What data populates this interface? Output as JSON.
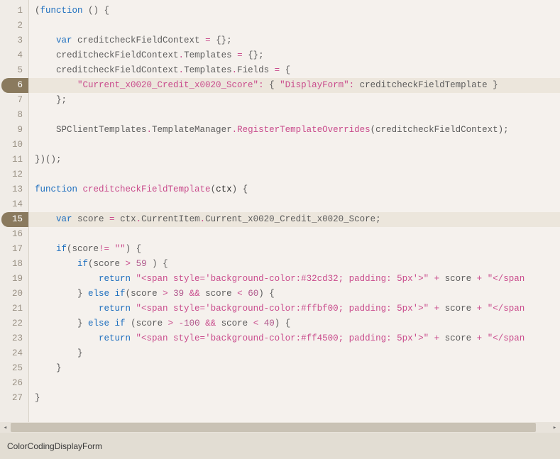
{
  "status_bar": {
    "filename": "ColorCodingDisplayForm"
  },
  "highlighted_lines": [
    6,
    15
  ],
  "code_lines": [
    {
      "n": 1,
      "tokens": [
        [
          "p",
          "("
        ],
        [
          "kw",
          "function"
        ],
        [
          "p",
          " () {"
        ]
      ]
    },
    {
      "n": 2,
      "tokens": []
    },
    {
      "n": 3,
      "tokens": [
        [
          "p",
          "    "
        ],
        [
          "kw",
          "var"
        ],
        [
          "p",
          " creditcheckFieldContext "
        ],
        [
          "op",
          "="
        ],
        [
          "p",
          " {};"
        ]
      ]
    },
    {
      "n": 4,
      "tokens": [
        [
          "p",
          "    creditcheckFieldContext"
        ],
        [
          "op",
          "."
        ],
        [
          "p",
          "Templates "
        ],
        [
          "op",
          "="
        ],
        [
          "p",
          " {};"
        ]
      ]
    },
    {
      "n": 5,
      "tokens": [
        [
          "p",
          "    creditcheckFieldContext"
        ],
        [
          "op",
          "."
        ],
        [
          "p",
          "Templates"
        ],
        [
          "op",
          "."
        ],
        [
          "p",
          "Fields "
        ],
        [
          "op",
          "="
        ],
        [
          "p",
          " {"
        ]
      ]
    },
    {
      "n": 6,
      "tokens": [
        [
          "p",
          "        "
        ],
        [
          "str",
          "\"Current_x0020_Credit_x0020_Score\""
        ],
        [
          "op",
          ":"
        ],
        [
          "p",
          " { "
        ],
        [
          "str",
          "\"DisplayForm\""
        ],
        [
          "op",
          ":"
        ],
        [
          "p",
          " creditcheckFieldTemplate }"
        ]
      ]
    },
    {
      "n": 7,
      "tokens": [
        [
          "p",
          "    };"
        ]
      ]
    },
    {
      "n": 8,
      "tokens": []
    },
    {
      "n": 9,
      "tokens": [
        [
          "p",
          "    SPClientTemplates"
        ],
        [
          "op",
          "."
        ],
        [
          "p",
          "TemplateManager"
        ],
        [
          "op",
          "."
        ],
        [
          "fn",
          "RegisterTemplateOverrides"
        ],
        [
          "p",
          "(creditcheckFieldContext);"
        ]
      ]
    },
    {
      "n": 10,
      "tokens": []
    },
    {
      "n": 11,
      "tokens": [
        [
          "p",
          "})();"
        ]
      ]
    },
    {
      "n": 12,
      "tokens": []
    },
    {
      "n": 13,
      "tokens": [
        [
          "kw",
          "function"
        ],
        [
          "p",
          " "
        ],
        [
          "fn",
          "creditcheckFieldTemplate"
        ],
        [
          "p",
          "("
        ],
        [
          "id",
          "ctx"
        ],
        [
          "p",
          ") {"
        ]
      ]
    },
    {
      "n": 14,
      "tokens": []
    },
    {
      "n": 15,
      "tokens": [
        [
          "p",
          "    "
        ],
        [
          "kw",
          "var"
        ],
        [
          "p",
          " score "
        ],
        [
          "op",
          "="
        ],
        [
          "p",
          " ctx"
        ],
        [
          "op",
          "."
        ],
        [
          "p",
          "CurrentItem"
        ],
        [
          "op",
          "."
        ],
        [
          "p",
          "Current_x0020_Credit_x0020_Score;"
        ]
      ]
    },
    {
      "n": 16,
      "tokens": []
    },
    {
      "n": 17,
      "tokens": [
        [
          "p",
          "    "
        ],
        [
          "kw",
          "if"
        ],
        [
          "p",
          "(score"
        ],
        [
          "op",
          "!="
        ],
        [
          "p",
          " "
        ],
        [
          "str",
          "\"\""
        ],
        [
          "p",
          ") {"
        ]
      ]
    },
    {
      "n": 18,
      "tokens": [
        [
          "p",
          "        "
        ],
        [
          "kw",
          "if"
        ],
        [
          "p",
          "(score "
        ],
        [
          "op",
          ">"
        ],
        [
          "p",
          " "
        ],
        [
          "num",
          "59"
        ],
        [
          "p",
          " ) {"
        ]
      ]
    },
    {
      "n": 19,
      "tokens": [
        [
          "p",
          "            "
        ],
        [
          "kw",
          "return"
        ],
        [
          "p",
          " "
        ],
        [
          "str",
          "\"<span style='background-color:#32cd32; padding: 5px'>\""
        ],
        [
          "p",
          " "
        ],
        [
          "op",
          "+"
        ],
        [
          "p",
          " score "
        ],
        [
          "op",
          "+"
        ],
        [
          "p",
          " "
        ],
        [
          "str",
          "\"</span"
        ]
      ]
    },
    {
      "n": 20,
      "tokens": [
        [
          "p",
          "        } "
        ],
        [
          "kw",
          "else"
        ],
        [
          "p",
          " "
        ],
        [
          "kw",
          "if"
        ],
        [
          "p",
          "(score "
        ],
        [
          "op",
          ">"
        ],
        [
          "p",
          " "
        ],
        [
          "num",
          "39"
        ],
        [
          "p",
          " "
        ],
        [
          "op",
          "&&"
        ],
        [
          "p",
          " score "
        ],
        [
          "op",
          "<"
        ],
        [
          "p",
          " "
        ],
        [
          "num",
          "60"
        ],
        [
          "p",
          ") {"
        ]
      ]
    },
    {
      "n": 21,
      "tokens": [
        [
          "p",
          "            "
        ],
        [
          "kw",
          "return"
        ],
        [
          "p",
          " "
        ],
        [
          "str",
          "\"<span style='background-color:#ffbf00; padding: 5px'>\""
        ],
        [
          "p",
          " "
        ],
        [
          "op",
          "+"
        ],
        [
          "p",
          " score "
        ],
        [
          "op",
          "+"
        ],
        [
          "p",
          " "
        ],
        [
          "str",
          "\"</span"
        ]
      ]
    },
    {
      "n": 22,
      "tokens": [
        [
          "p",
          "        } "
        ],
        [
          "kw",
          "else"
        ],
        [
          "p",
          " "
        ],
        [
          "kw",
          "if"
        ],
        [
          "p",
          " (score "
        ],
        [
          "op",
          ">"
        ],
        [
          "p",
          " "
        ],
        [
          "op",
          "-"
        ],
        [
          "num",
          "100"
        ],
        [
          "p",
          " "
        ],
        [
          "op",
          "&&"
        ],
        [
          "p",
          " score "
        ],
        [
          "op",
          "<"
        ],
        [
          "p",
          " "
        ],
        [
          "num",
          "40"
        ],
        [
          "p",
          ") {"
        ]
      ]
    },
    {
      "n": 23,
      "tokens": [
        [
          "p",
          "            "
        ],
        [
          "kw",
          "return"
        ],
        [
          "p",
          " "
        ],
        [
          "str",
          "\"<span style='background-color:#ff4500; padding: 5px'>\""
        ],
        [
          "p",
          " "
        ],
        [
          "op",
          "+"
        ],
        [
          "p",
          " score "
        ],
        [
          "op",
          "+"
        ],
        [
          "p",
          " "
        ],
        [
          "str",
          "\"</span"
        ]
      ]
    },
    {
      "n": 24,
      "tokens": [
        [
          "p",
          "        }"
        ]
      ]
    },
    {
      "n": 25,
      "tokens": [
        [
          "p",
          "    }"
        ]
      ]
    },
    {
      "n": 26,
      "tokens": []
    },
    {
      "n": 27,
      "tokens": [
        [
          "p",
          "}"
        ]
      ]
    }
  ]
}
